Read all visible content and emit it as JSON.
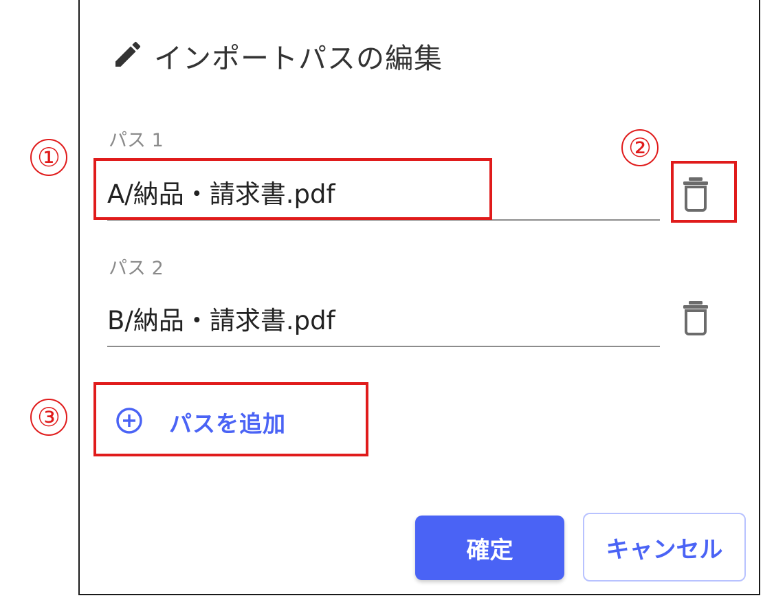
{
  "dialog": {
    "title": "インポートパスの編集",
    "title_icon": "pencil-icon",
    "paths": [
      {
        "label": "パス 1",
        "value": "A/納品・請求書.pdf",
        "delete_icon": "trash-icon"
      },
      {
        "label": "パス 2",
        "value": "B/納品・請求書.pdf",
        "delete_icon": "trash-icon"
      }
    ],
    "add_path": {
      "label": "パスを追加",
      "icon": "plus-circle-icon"
    },
    "buttons": {
      "confirm": "確定",
      "cancel": "キャンセル"
    }
  },
  "annotations": {
    "n1": "①",
    "n2": "②",
    "n3": "③"
  },
  "colors": {
    "accent": "#4a63f5",
    "annotation": "#e01b1b",
    "text": "#222222",
    "label": "#8a8a8a"
  }
}
